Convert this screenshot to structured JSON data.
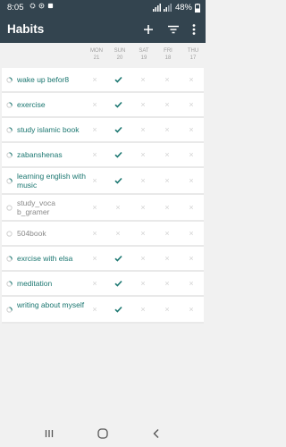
{
  "status": {
    "time": "8:05",
    "battery": "48%"
  },
  "appbar": {
    "title": "Habits"
  },
  "days": [
    {
      "dow": "MON",
      "day": "21"
    },
    {
      "dow": "SUN",
      "day": "20"
    },
    {
      "dow": "SAT",
      "day": "19"
    },
    {
      "dow": "FRI",
      "day": "18"
    },
    {
      "dow": "THU",
      "day": "17"
    }
  ],
  "habits": [
    {
      "name": "wake up befor8",
      "color": "#1a7670",
      "progress": 0.3,
      "checks": [
        false,
        true,
        false,
        false,
        false
      ]
    },
    {
      "name": "exercise",
      "color": "#1a7670",
      "progress": 0.3,
      "checks": [
        false,
        true,
        false,
        false,
        false
      ]
    },
    {
      "name": "study islamic book",
      "color": "#1a7670",
      "progress": 0.3,
      "checks": [
        false,
        true,
        false,
        false,
        false
      ]
    },
    {
      "name": "zabanshenas",
      "color": "#1a7670",
      "progress": 0.3,
      "checks": [
        false,
        true,
        false,
        false,
        false
      ]
    },
    {
      "name": "learning english with music",
      "color": "#1a7670",
      "progress": 0.3,
      "checks": [
        false,
        true,
        false,
        false,
        false
      ]
    },
    {
      "name": "study_voca b_gramer",
      "color": "#8a8a8a",
      "progress": 0,
      "checks": [
        false,
        false,
        false,
        false,
        false
      ]
    },
    {
      "name": "504book",
      "color": "#8a8a8a",
      "progress": 0,
      "checks": [
        false,
        false,
        false,
        false,
        false
      ]
    },
    {
      "name": "exrcise with elsa",
      "color": "#1a7670",
      "progress": 0.3,
      "checks": [
        false,
        true,
        false,
        false,
        false
      ]
    },
    {
      "name": "meditation",
      "color": "#1a7670",
      "progress": 0.3,
      "checks": [
        false,
        true,
        false,
        false,
        false
      ]
    },
    {
      "name": "writing about myself",
      "color": "#1a7670",
      "progress": 0.3,
      "checks": [
        false,
        true,
        false,
        false,
        false
      ]
    }
  ]
}
